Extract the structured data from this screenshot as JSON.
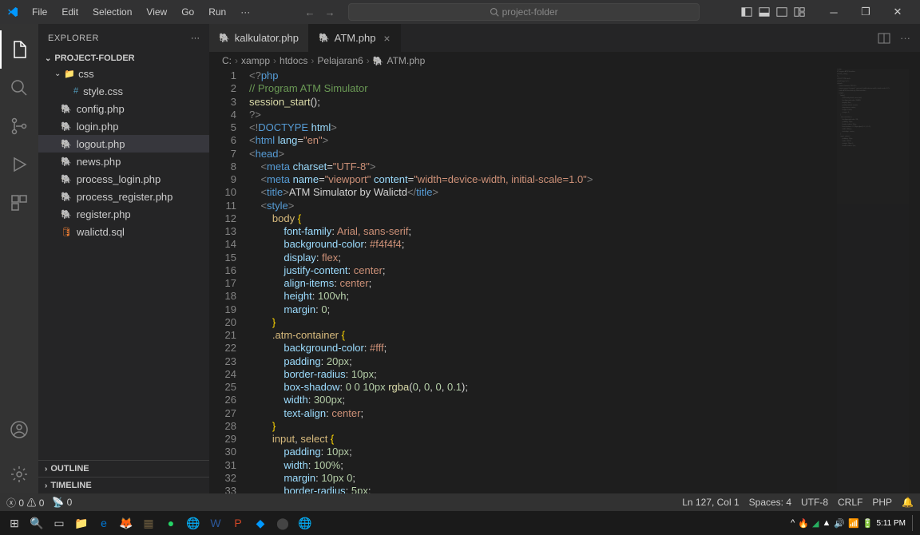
{
  "menu": [
    "File",
    "Edit",
    "Selection",
    "View",
    "Go",
    "Run",
    "···"
  ],
  "search": {
    "placeholder": "project-folder"
  },
  "sidebar": {
    "title": "EXPLORER",
    "project": "PROJECT-FOLDER",
    "folders": [
      {
        "name": "css",
        "children": [
          {
            "name": "style.css",
            "type": "css"
          }
        ]
      }
    ],
    "files": [
      {
        "name": "config.php",
        "type": "php"
      },
      {
        "name": "login.php",
        "type": "php"
      },
      {
        "name": "logout.php",
        "type": "php",
        "active": true
      },
      {
        "name": "news.php",
        "type": "php"
      },
      {
        "name": "process_login.php",
        "type": "php"
      },
      {
        "name": "process_register.php",
        "type": "php"
      },
      {
        "name": "register.php",
        "type": "php"
      },
      {
        "name": "walictd.sql",
        "type": "sql"
      }
    ],
    "outline": "OUTLINE",
    "timeline": "TIMELINE"
  },
  "tabs": [
    {
      "name": "kalkulator.php",
      "active": false
    },
    {
      "name": "ATM.php",
      "active": true
    }
  ],
  "breadcrumb": [
    "C:",
    "xampp",
    "htdocs",
    "Pelajaran6",
    "ATM.php"
  ],
  "code": [
    {
      "n": 1,
      "tokens": [
        [
          "<?",
          "tag"
        ],
        [
          "php",
          "php"
        ]
      ]
    },
    {
      "n": 2,
      "tokens": [
        [
          "// Program ATM Simulator",
          "comment"
        ]
      ]
    },
    {
      "n": 3,
      "tokens": [
        [
          "session_start",
          "func"
        ],
        [
          "();",
          "text"
        ]
      ]
    },
    {
      "n": 4,
      "tokens": [
        [
          "?>",
          "tag"
        ]
      ]
    },
    {
      "n": 5,
      "tokens": [
        [
          "<!",
          "tag"
        ],
        [
          "DOCTYPE",
          "tagname"
        ],
        [
          " html",
          "attr"
        ],
        [
          ">",
          "tag"
        ]
      ]
    },
    {
      "n": 6,
      "tokens": [
        [
          "<",
          "tag"
        ],
        [
          "html",
          "tagname"
        ],
        [
          " lang",
          "attr"
        ],
        [
          "=",
          "text"
        ],
        [
          "\"en\"",
          "string"
        ],
        [
          ">",
          "tag"
        ]
      ]
    },
    {
      "n": 7,
      "tokens": [
        [
          "<",
          "tag"
        ],
        [
          "head",
          "tagname"
        ],
        [
          ">",
          "tag"
        ]
      ]
    },
    {
      "n": 8,
      "tokens": [
        [
          "    ",
          "text"
        ],
        [
          "<",
          "tag"
        ],
        [
          "meta",
          "tagname"
        ],
        [
          " charset",
          "attr"
        ],
        [
          "=",
          "text"
        ],
        [
          "\"UTF-8\"",
          "string"
        ],
        [
          ">",
          "tag"
        ]
      ]
    },
    {
      "n": 9,
      "tokens": [
        [
          "    ",
          "text"
        ],
        [
          "<",
          "tag"
        ],
        [
          "meta",
          "tagname"
        ],
        [
          " name",
          "attr"
        ],
        [
          "=",
          "text"
        ],
        [
          "\"viewport\"",
          "string"
        ],
        [
          " content",
          "attr"
        ],
        [
          "=",
          "text"
        ],
        [
          "\"width=device-width, initial-scale=1.0\"",
          "string"
        ],
        [
          ">",
          "tag"
        ]
      ]
    },
    {
      "n": 10,
      "tokens": [
        [
          "    ",
          "text"
        ],
        [
          "<",
          "tag"
        ],
        [
          "title",
          "tagname"
        ],
        [
          ">",
          "tag"
        ],
        [
          "ATM Simulator by Walictd",
          "text"
        ],
        [
          "</",
          "tag"
        ],
        [
          "title",
          "tagname"
        ],
        [
          ">",
          "tag"
        ]
      ]
    },
    {
      "n": 11,
      "tokens": [
        [
          "    ",
          "text"
        ],
        [
          "<",
          "tag"
        ],
        [
          "style",
          "tagname"
        ],
        [
          ">",
          "tag"
        ]
      ]
    },
    {
      "n": 12,
      "tokens": [
        [
          "        ",
          "text"
        ],
        [
          "body",
          "sel"
        ],
        [
          " {",
          "brace"
        ]
      ]
    },
    {
      "n": 13,
      "tokens": [
        [
          "            ",
          "text"
        ],
        [
          "font-family",
          "prop"
        ],
        [
          ":",
          "text"
        ],
        [
          " Arial, sans-serif",
          "val"
        ],
        [
          ";",
          "text"
        ]
      ]
    },
    {
      "n": 14,
      "tokens": [
        [
          "            ",
          "text"
        ],
        [
          "background-color",
          "prop"
        ],
        [
          ":",
          "text"
        ],
        [
          " #f4f4f4",
          "val"
        ],
        [
          ";",
          "text"
        ]
      ]
    },
    {
      "n": 15,
      "tokens": [
        [
          "            ",
          "text"
        ],
        [
          "display",
          "prop"
        ],
        [
          ":",
          "text"
        ],
        [
          " flex",
          "val"
        ],
        [
          ";",
          "text"
        ]
      ]
    },
    {
      "n": 16,
      "tokens": [
        [
          "            ",
          "text"
        ],
        [
          "justify-content",
          "prop"
        ],
        [
          ":",
          "text"
        ],
        [
          " center",
          "val"
        ],
        [
          ";",
          "text"
        ]
      ]
    },
    {
      "n": 17,
      "tokens": [
        [
          "            ",
          "text"
        ],
        [
          "align-items",
          "prop"
        ],
        [
          ":",
          "text"
        ],
        [
          " center",
          "val"
        ],
        [
          ";",
          "text"
        ]
      ]
    },
    {
      "n": 18,
      "tokens": [
        [
          "            ",
          "text"
        ],
        [
          "height",
          "prop"
        ],
        [
          ":",
          "text"
        ],
        [
          " 100vh",
          "num"
        ],
        [
          ";",
          "text"
        ]
      ]
    },
    {
      "n": 19,
      "tokens": [
        [
          "            ",
          "text"
        ],
        [
          "margin",
          "prop"
        ],
        [
          ":",
          "text"
        ],
        [
          " 0",
          "num"
        ],
        [
          ";",
          "text"
        ]
      ]
    },
    {
      "n": 20,
      "tokens": [
        [
          "        ",
          "text"
        ],
        [
          "}",
          "brace"
        ]
      ]
    },
    {
      "n": 21,
      "tokens": [
        [
          "        ",
          "text"
        ],
        [
          ".atm-container",
          "sel"
        ],
        [
          " {",
          "brace"
        ]
      ]
    },
    {
      "n": 22,
      "tokens": [
        [
          "            ",
          "text"
        ],
        [
          "background-color",
          "prop"
        ],
        [
          ":",
          "text"
        ],
        [
          " #fff",
          "val"
        ],
        [
          ";",
          "text"
        ]
      ]
    },
    {
      "n": 23,
      "tokens": [
        [
          "            ",
          "text"
        ],
        [
          "padding",
          "prop"
        ],
        [
          ":",
          "text"
        ],
        [
          " 20px",
          "num"
        ],
        [
          ";",
          "text"
        ]
      ]
    },
    {
      "n": 24,
      "tokens": [
        [
          "            ",
          "text"
        ],
        [
          "border-radius",
          "prop"
        ],
        [
          ":",
          "text"
        ],
        [
          " 10px",
          "num"
        ],
        [
          ";",
          "text"
        ]
      ]
    },
    {
      "n": 25,
      "tokens": [
        [
          "            ",
          "text"
        ],
        [
          "box-shadow",
          "prop"
        ],
        [
          ":",
          "text"
        ],
        [
          " 0",
          "num"
        ],
        [
          " 0",
          "num"
        ],
        [
          " 10px",
          "num"
        ],
        [
          " rgba",
          "func"
        ],
        [
          "(",
          "text"
        ],
        [
          "0",
          "num"
        ],
        [
          ", ",
          "text"
        ],
        [
          "0",
          "num"
        ],
        [
          ", ",
          "text"
        ],
        [
          "0",
          "num"
        ],
        [
          ", ",
          "text"
        ],
        [
          "0.1",
          "num"
        ],
        [
          ");",
          "text"
        ]
      ]
    },
    {
      "n": 26,
      "tokens": [
        [
          "            ",
          "text"
        ],
        [
          "width",
          "prop"
        ],
        [
          ":",
          "text"
        ],
        [
          " 300px",
          "num"
        ],
        [
          ";",
          "text"
        ]
      ]
    },
    {
      "n": 27,
      "tokens": [
        [
          "            ",
          "text"
        ],
        [
          "text-align",
          "prop"
        ],
        [
          ":",
          "text"
        ],
        [
          " center",
          "val"
        ],
        [
          ";",
          "text"
        ]
      ]
    },
    {
      "n": 28,
      "tokens": [
        [
          "        ",
          "text"
        ],
        [
          "}",
          "brace"
        ]
      ]
    },
    {
      "n": 29,
      "tokens": [
        [
          "        ",
          "text"
        ],
        [
          "input",
          "sel"
        ],
        [
          ", ",
          "text"
        ],
        [
          "select",
          "sel"
        ],
        [
          " {",
          "brace"
        ]
      ]
    },
    {
      "n": 30,
      "tokens": [
        [
          "            ",
          "text"
        ],
        [
          "padding",
          "prop"
        ],
        [
          ":",
          "text"
        ],
        [
          " 10px",
          "num"
        ],
        [
          ";",
          "text"
        ]
      ]
    },
    {
      "n": 31,
      "tokens": [
        [
          "            ",
          "text"
        ],
        [
          "width",
          "prop"
        ],
        [
          ":",
          "text"
        ],
        [
          " 100%",
          "num"
        ],
        [
          ";",
          "text"
        ]
      ]
    },
    {
      "n": 32,
      "tokens": [
        [
          "            ",
          "text"
        ],
        [
          "margin",
          "prop"
        ],
        [
          ":",
          "text"
        ],
        [
          " 10px",
          "num"
        ],
        [
          " 0",
          "num"
        ],
        [
          ";",
          "text"
        ]
      ]
    },
    {
      "n": 33,
      "tokens": [
        [
          "            ",
          "text"
        ],
        [
          "border-radius",
          "prop"
        ],
        [
          ":",
          "text"
        ],
        [
          " 5px",
          "num"
        ],
        [
          ";",
          "text"
        ]
      ]
    }
  ],
  "status": {
    "left": {
      "errors": "0",
      "warnings": "0",
      "ports": "0"
    },
    "right": {
      "lncol": "Ln 127, Col 1",
      "spaces": "Spaces: 4",
      "encoding": "UTF-8",
      "eol": "CRLF",
      "lang": "PHP"
    }
  },
  "taskbar": {
    "time": "5:11 PM"
  }
}
